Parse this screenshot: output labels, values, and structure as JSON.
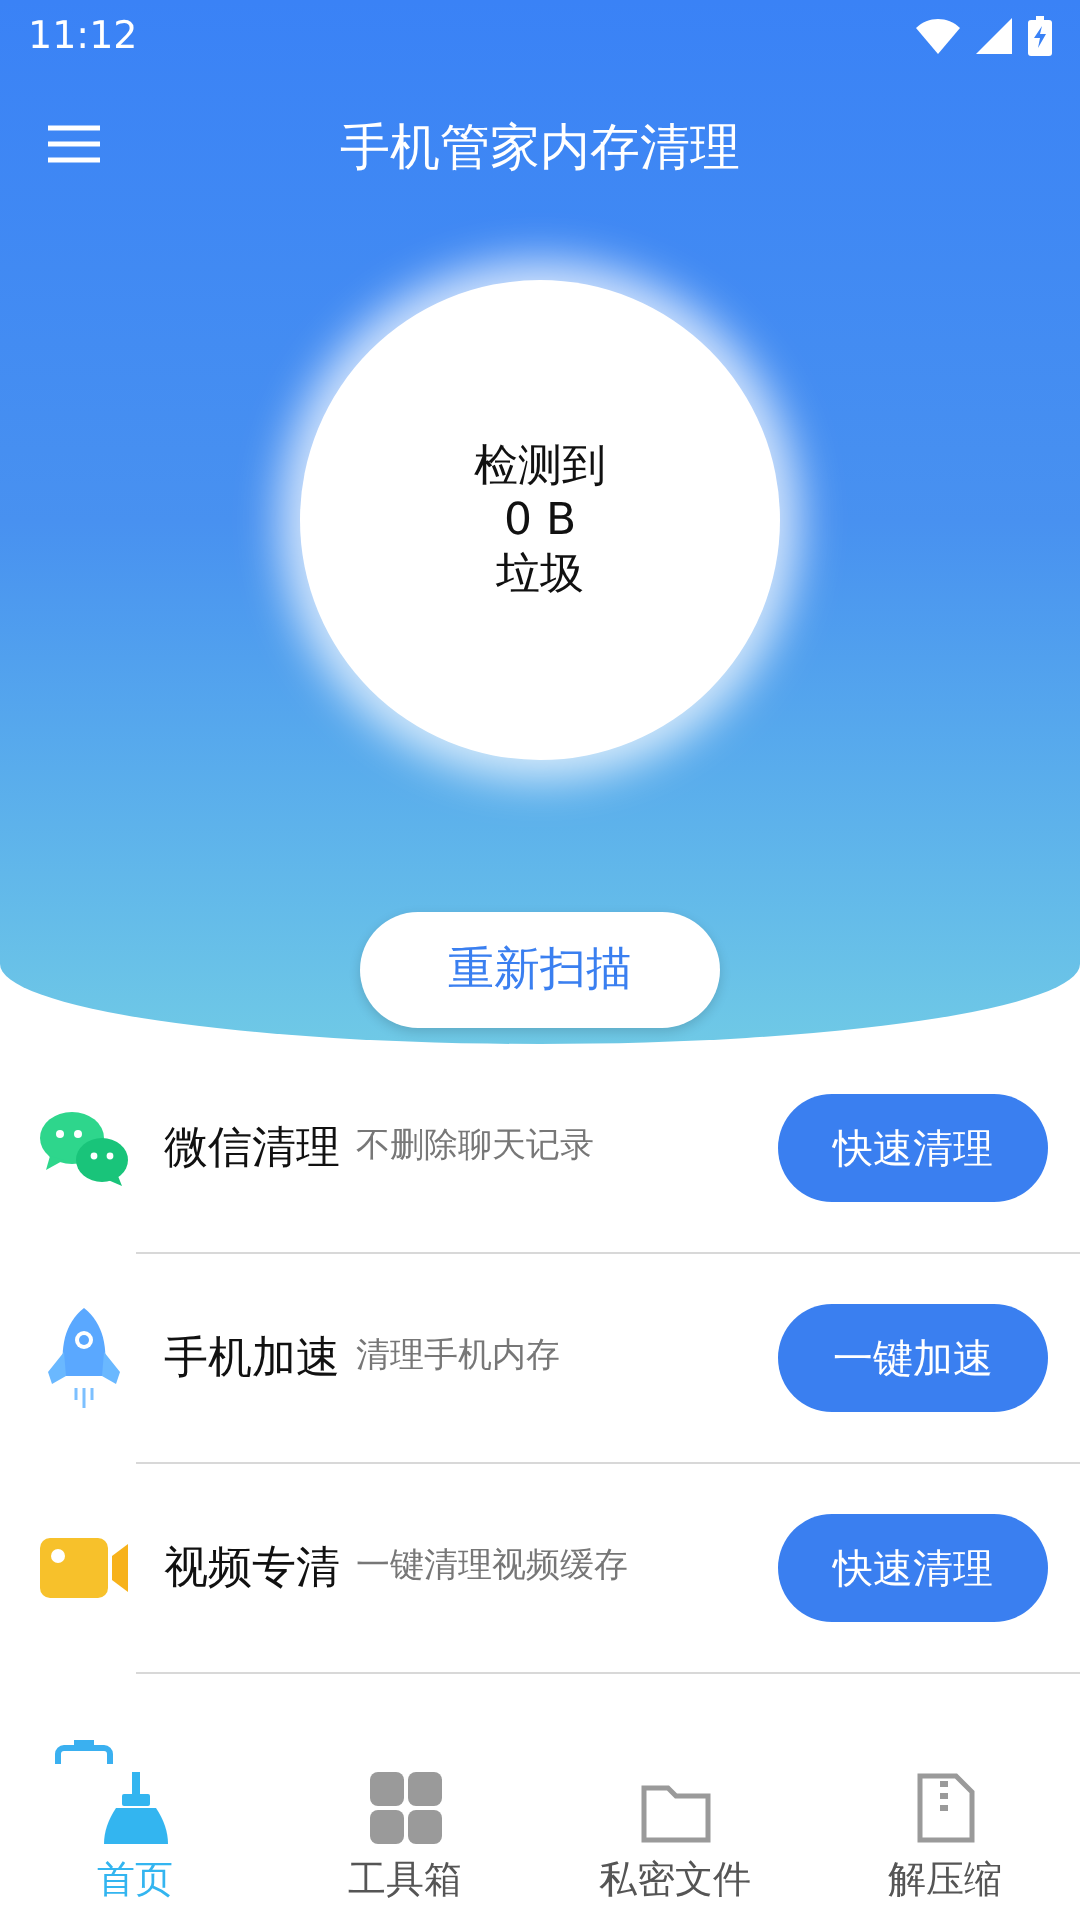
{
  "status_bar": {
    "time": "11:12"
  },
  "header": {
    "title": "手机管家内存清理"
  },
  "scan_result": {
    "line_1": "检测到",
    "size": "0 B",
    "line_2": "垃圾"
  },
  "rescan_button": "重新扫描",
  "features": [
    {
      "kind": "chat",
      "title": "微信清理",
      "subtitle": "不删除聊天记录",
      "action": "快速清理"
    },
    {
      "kind": "rocket",
      "title": "手机加速",
      "subtitle": "清理手机内存",
      "action": "一键加速"
    },
    {
      "kind": "video",
      "title": "视频专清",
      "subtitle": "一键清理视频缓存",
      "action": "快速清理"
    },
    {
      "kind": "battery"
    }
  ],
  "bottom_nav": [
    {
      "kind": "broom",
      "label": "首页",
      "selected": true
    },
    {
      "kind": "grid",
      "label": "工具箱",
      "selected": false
    },
    {
      "kind": "folder",
      "label": "私密文件",
      "selected": false
    },
    {
      "kind": "zip",
      "label": "解压缩",
      "selected": false
    }
  ]
}
